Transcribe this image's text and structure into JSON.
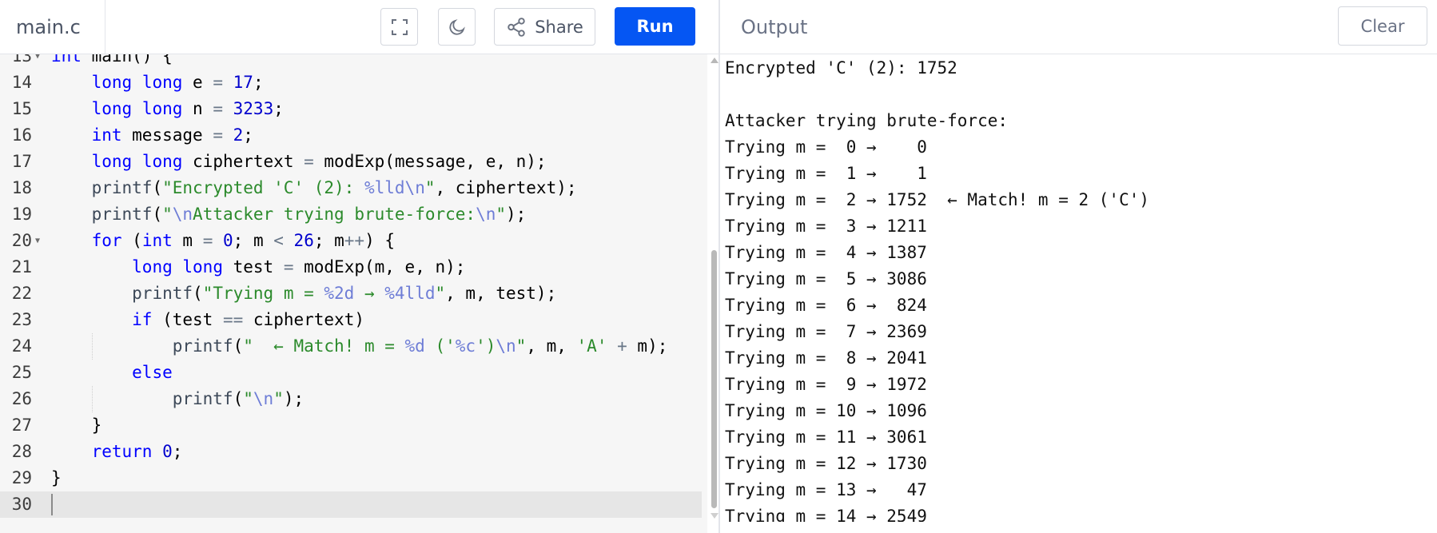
{
  "header": {
    "file_name": "main.c",
    "share_label": "Share",
    "run_label": "Run",
    "output_title": "Output",
    "clear_label": "Clear",
    "icons": [
      "fullscreen-icon",
      "moon-icon",
      "share-icon"
    ],
    "colors": {
      "run_button": "#0556f3"
    }
  },
  "editor": {
    "line_numbers": [
      "13",
      "14",
      "15",
      "16",
      "17",
      "18",
      "19",
      "20",
      "21",
      "22",
      "23",
      "24",
      "25",
      "26",
      "27",
      "28",
      "29",
      "30"
    ],
    "folded_lines": [
      "13",
      "20"
    ],
    "active_line": "30",
    "lines": [
      "int main() {",
      "    long long e = 17;",
      "    long long n = 3233;",
      "    int message = 2;",
      "    long long ciphertext = modExp(message, e, n);",
      "    printf(\"Encrypted 'C' (2): %lld\\n\", ciphertext);",
      "    printf(\"\\nAttacker trying brute-force:\\n\");",
      "    for (int m = 0; m < 26; m++) {",
      "        long long test = modExp(m, e, n);",
      "        printf(\"Trying m = %2d → %4lld\", m, test);",
      "        if (test == ciphertext)",
      "            printf(\"  ← Match! m = %d ('%c')\\n\", m, 'A' + m);",
      "        else",
      "            printf(\"\\n\");",
      "    }",
      "    return 0;",
      "}",
      ""
    ]
  },
  "output": {
    "lines": [
      "Encrypted 'C' (2): 1752",
      "",
      "Attacker trying brute-force:",
      "Trying m =  0 →    0",
      "Trying m =  1 →    1",
      "Trying m =  2 → 1752  ← Match! m = 2 ('C')",
      "Trying m =  3 → 1211",
      "Trying m =  4 → 1387",
      "Trying m =  5 → 3086",
      "Trying m =  6 →  824",
      "Trying m =  7 → 2369",
      "Trying m =  8 → 2041",
      "Trying m =  9 → 1972",
      "Trying m = 10 → 1096",
      "Trying m = 11 → 3061",
      "Trying m = 12 → 1730",
      "Trying m = 13 →   47",
      "Trying m = 14 → 2549"
    ]
  }
}
